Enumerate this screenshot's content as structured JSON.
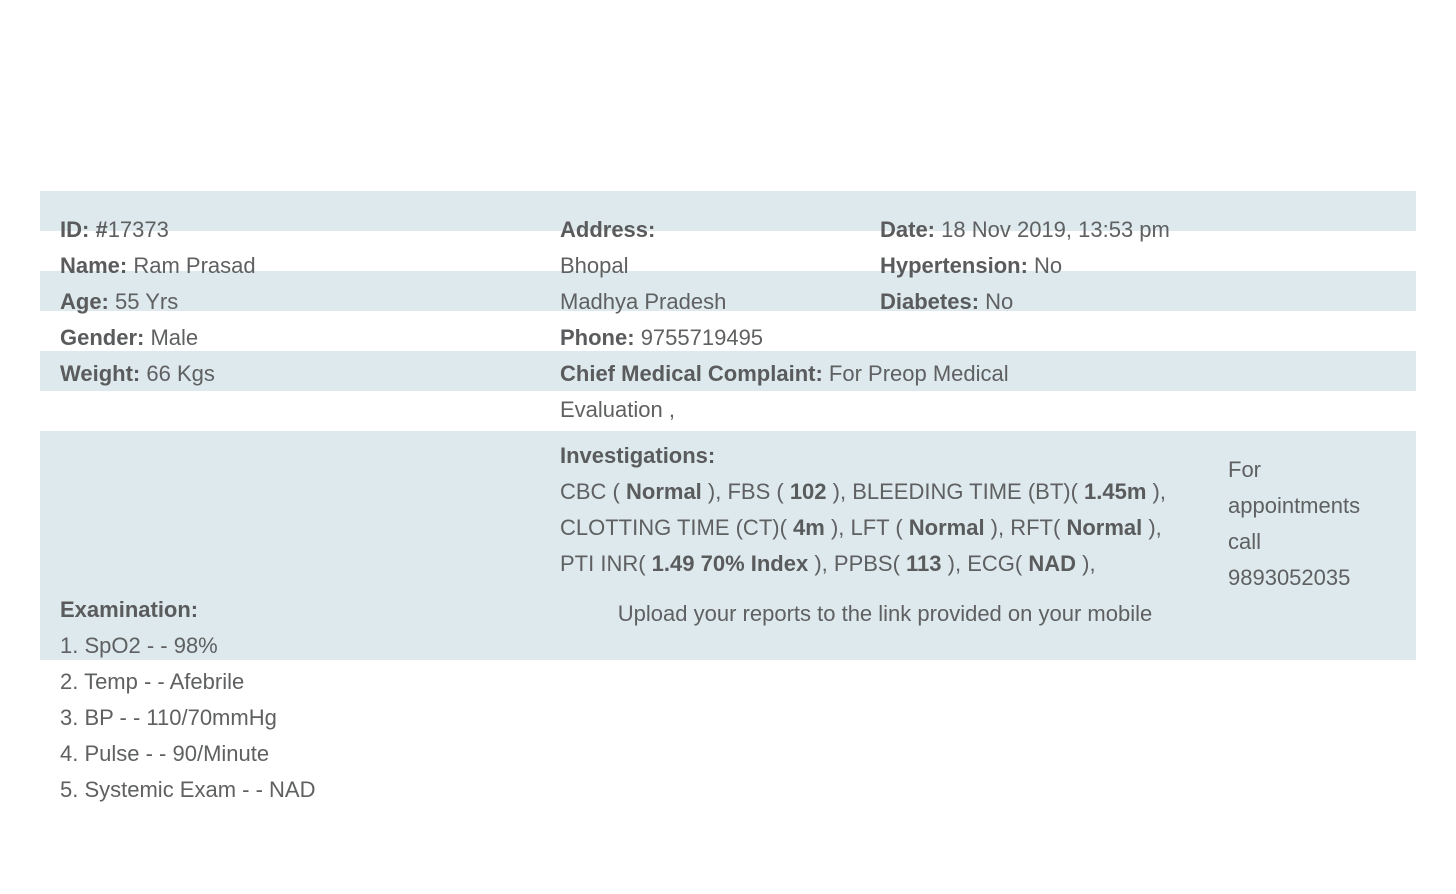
{
  "patient": {
    "id_label": "ID:",
    "id_value": "#17373",
    "name_label": "Name:",
    "name_value": "Ram Prasad",
    "age_label": "Age:",
    "age_value": "55 Yrs",
    "gender_label": "Gender:",
    "gender_value": "Male",
    "weight_label": "Weight:",
    "weight_value": "66 Kgs"
  },
  "address": {
    "label": "Address:",
    "line1": "Bhopal",
    "line2": "Madhya Pradesh",
    "phone_label": "Phone:",
    "phone_value": "9755719495"
  },
  "visit": {
    "date_label": "Date:",
    "date_value": "18 Nov 2019, 13:53 pm",
    "hypertension_label": "Hypertension:",
    "hypertension_value": "No",
    "diabetes_label": "Diabetes:",
    "diabetes_value": "No"
  },
  "complaint": {
    "label": "Chief Medical Complaint:",
    "value_line1": "For Preop Medical",
    "value_line2": "Evaluation ,"
  },
  "investigations": {
    "label": "Investigations:",
    "cbc": {
      "pre": "CBC ( ",
      "value": "Normal",
      "post": " ), "
    },
    "fbs": {
      "pre": "FBS ( ",
      "value": "102",
      "post": " ), "
    },
    "bt": {
      "pre": "BLEEDING TIME (BT)( ",
      "value": "1.45m",
      "post": " ),"
    },
    "ct": {
      "pre": "CLOTTING TIME (CT)( ",
      "value": "4m",
      "post": " ), "
    },
    "lft": {
      "pre": "LFT ( ",
      "value": "Normal",
      "post": " ), "
    },
    "rft": {
      "pre": "RFT( ",
      "value": "Normal",
      "post": " ),"
    },
    "pti": {
      "pre": "PTI INR( ",
      "value": "1.49 70% Index",
      "post": " ), "
    },
    "ppbs": {
      "pre": "PPBS( ",
      "value": "113",
      "post": " ), "
    },
    "ecg": {
      "pre": "ECG( ",
      "value": "NAD",
      "post": " ),"
    }
  },
  "appointments": {
    "line1": "For",
    "line2": "appointments",
    "line3": "call",
    "line4": "9893052035"
  },
  "upload_note": "Upload your reports to the link provided on your mobile",
  "examination": {
    "label": "Examination:",
    "items": [
      "1. SpO2 - - 98%",
      "2. Temp - - Afebrile",
      "3. BP - - 110/70mmHg",
      "4. Pulse - - 90/Minute",
      "5. Systemic Exam - - NAD"
    ]
  }
}
